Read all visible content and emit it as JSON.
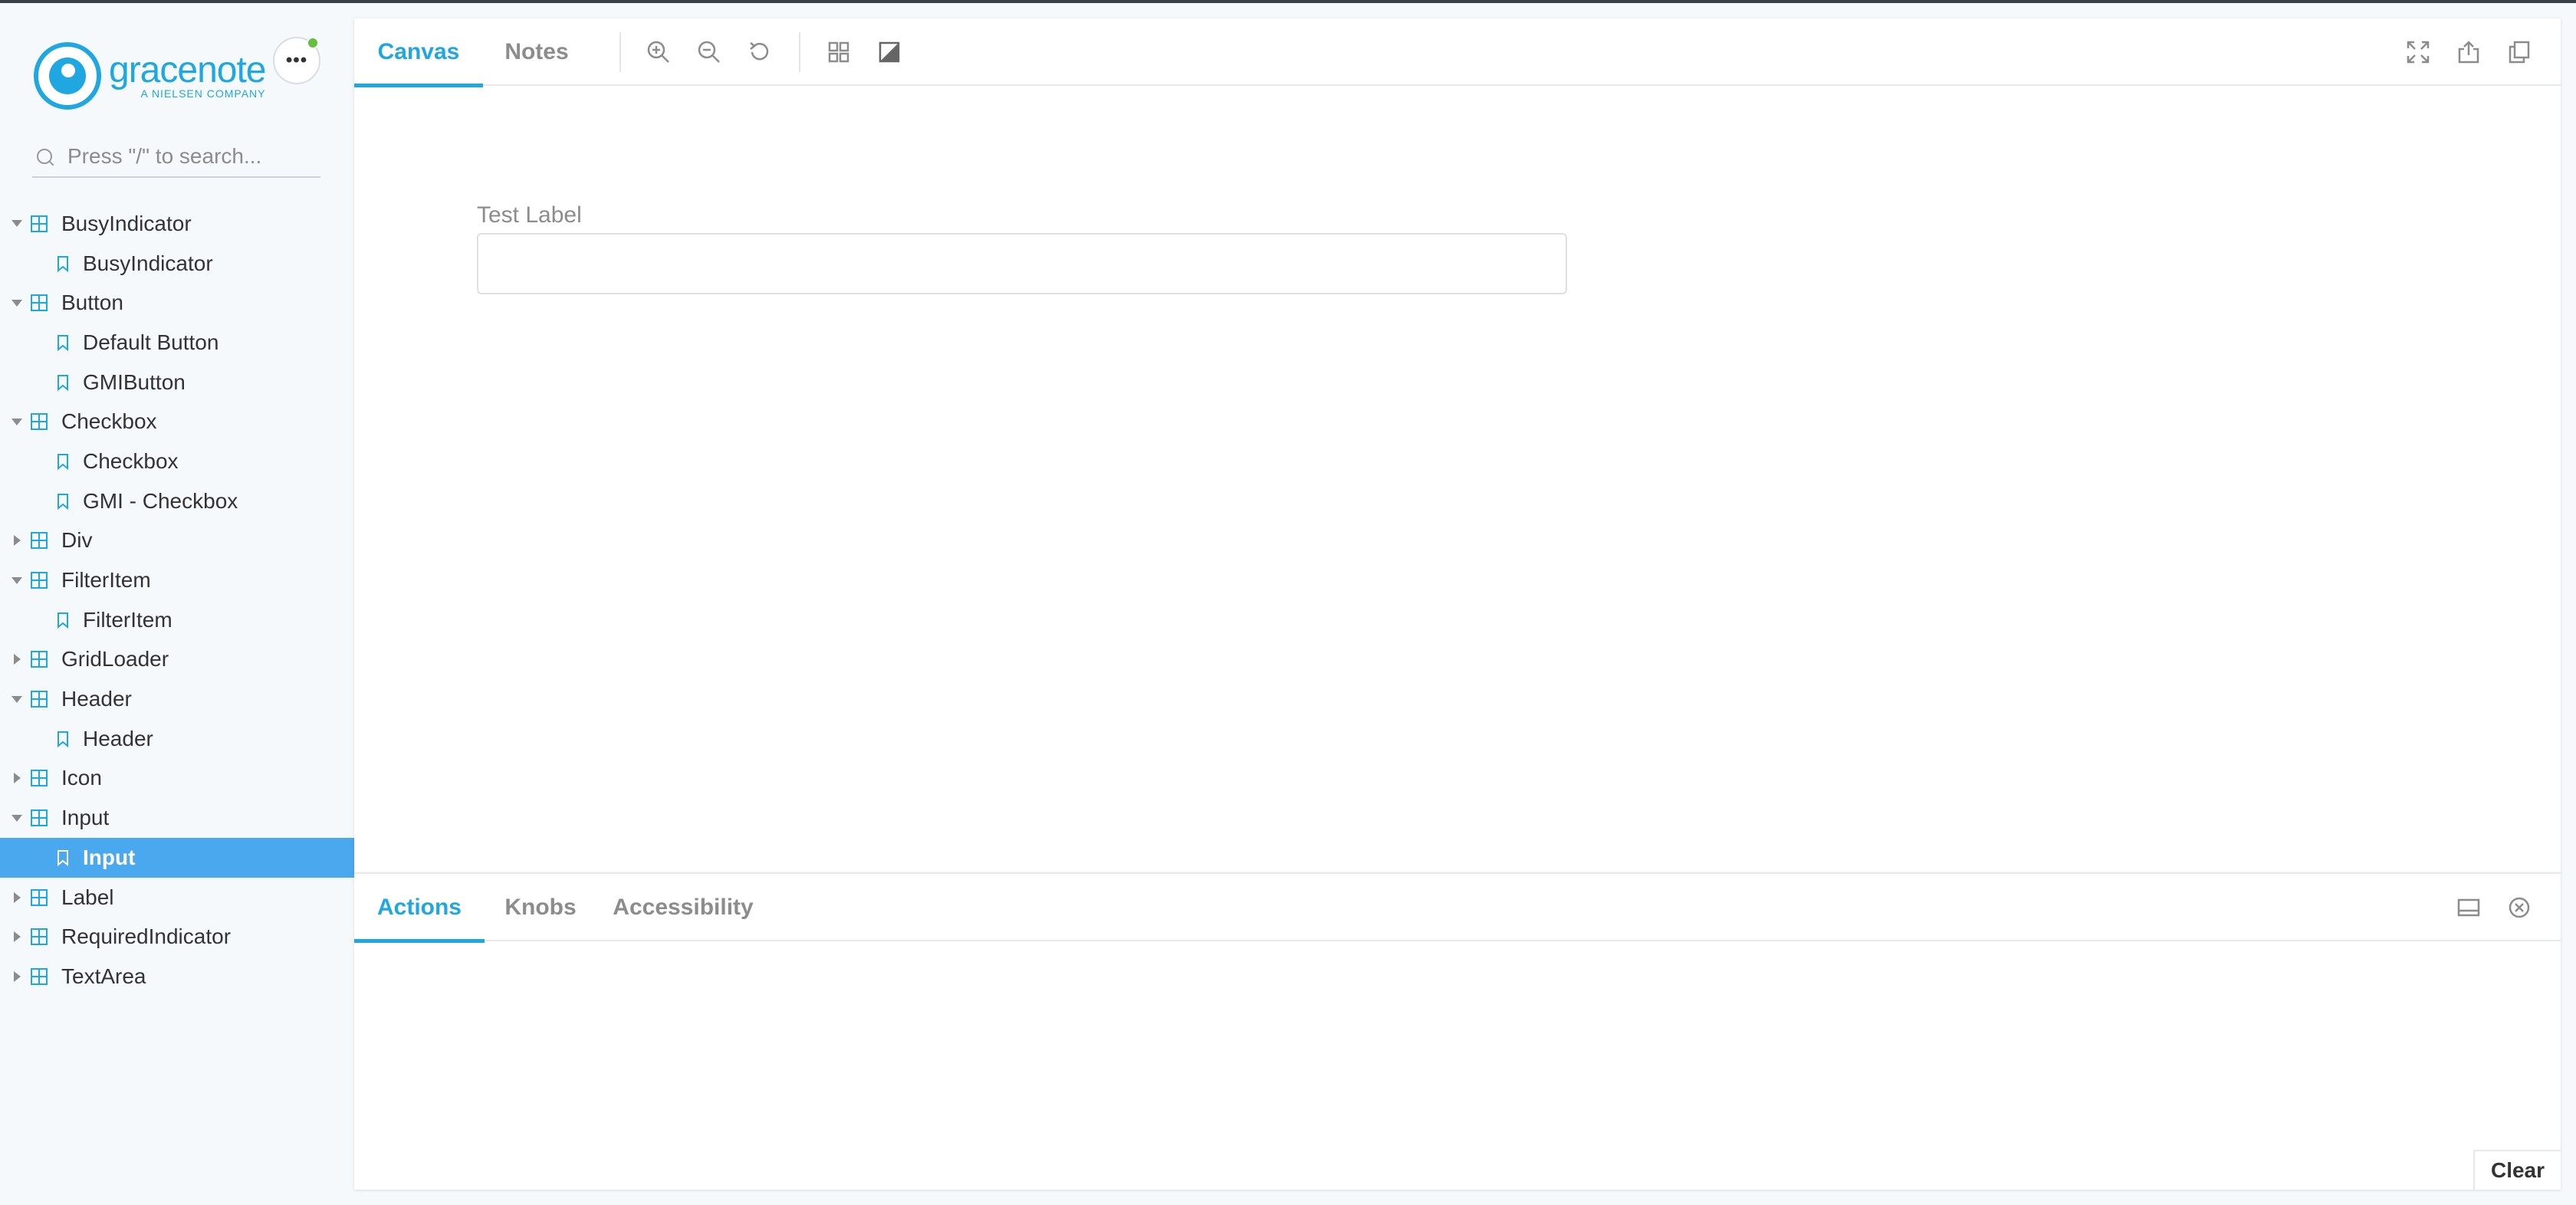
{
  "sidebar": {
    "brand": {
      "name": "gracenote",
      "tagline": "A NIELSEN COMPANY",
      "color": "#1ea7e1"
    },
    "menu_label": "•••",
    "search": {
      "placeholder": "Press \"/\" to search...",
      "value": ""
    },
    "tree": [
      {
        "label": "BusyIndicator",
        "kind": "component",
        "expanded": true
      },
      {
        "label": "BusyIndicator",
        "kind": "story"
      },
      {
        "label": "Button",
        "kind": "component",
        "expanded": true
      },
      {
        "label": "Default Button",
        "kind": "story"
      },
      {
        "label": "GMIButton",
        "kind": "story"
      },
      {
        "label": "Checkbox",
        "kind": "component",
        "expanded": true
      },
      {
        "label": "Checkbox",
        "kind": "story"
      },
      {
        "label": "GMI - Checkbox",
        "kind": "story"
      },
      {
        "label": "Div",
        "kind": "component",
        "expanded": false
      },
      {
        "label": "FilterItem",
        "kind": "component",
        "expanded": true
      },
      {
        "label": "FilterItem",
        "kind": "story"
      },
      {
        "label": "GridLoader",
        "kind": "component",
        "expanded": false
      },
      {
        "label": "Header",
        "kind": "component",
        "expanded": true
      },
      {
        "label": "Header",
        "kind": "story"
      },
      {
        "label": "Icon",
        "kind": "component",
        "expanded": false
      },
      {
        "label": "Input",
        "kind": "component",
        "expanded": true
      },
      {
        "label": "Input",
        "kind": "story",
        "selected": true
      },
      {
        "label": "Label",
        "kind": "component",
        "expanded": false
      },
      {
        "label": "RequiredIndicator",
        "kind": "component",
        "expanded": false
      },
      {
        "label": "TextArea",
        "kind": "component",
        "expanded": false
      }
    ]
  },
  "toolbar": {
    "tabs": [
      {
        "label": "Canvas",
        "active": true
      },
      {
        "label": "Notes",
        "active": false
      }
    ],
    "tools": [
      "zoom-in-icon",
      "zoom-out-icon",
      "reset-zoom-icon",
      "grid-icon",
      "background-contrast-icon"
    ],
    "right_tools": [
      "fullscreen-icon",
      "share-icon",
      "copy-icon"
    ]
  },
  "canvas": {
    "field_label": "Test Label",
    "field_value": ""
  },
  "addons": {
    "tabs": [
      {
        "label": "Actions",
        "active": true
      },
      {
        "label": "Knobs",
        "active": false
      },
      {
        "label": "Accessibility",
        "active": false
      }
    ],
    "clear_label": "Clear"
  },
  "colors": {
    "accent": "#1ea7e1",
    "selected_bg": "#4aa8ee",
    "status_dot": "#66bf3c"
  }
}
